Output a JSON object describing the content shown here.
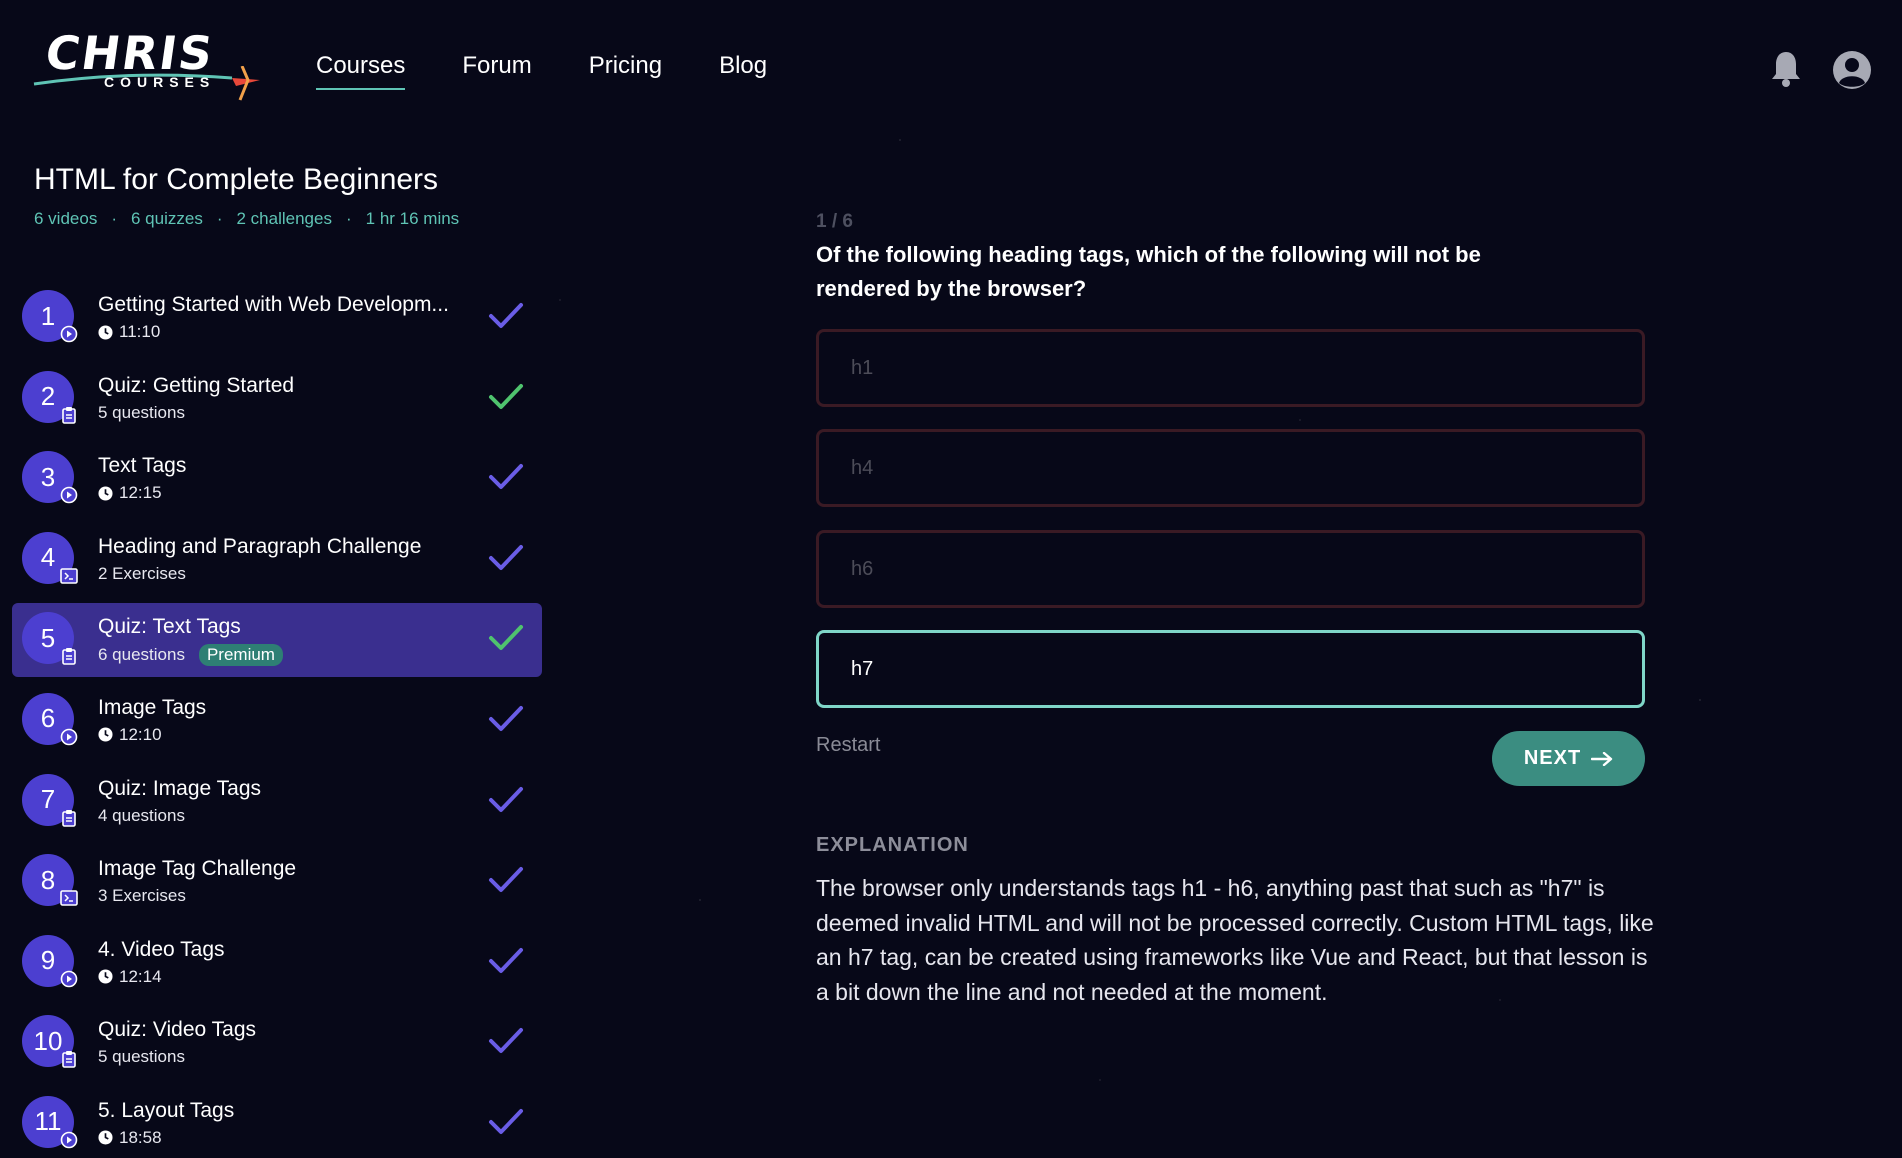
{
  "navbar": {
    "logo_main": "CHRIS",
    "logo_sub": "COURSES",
    "links": [
      {
        "label": "Courses",
        "active": true
      },
      {
        "label": "Forum"
      },
      {
        "label": "Pricing"
      },
      {
        "label": "Blog"
      }
    ],
    "icons": [
      "bell-icon",
      "user-avatar-icon"
    ]
  },
  "course": {
    "title": "HTML for Complete Beginners",
    "meta": [
      "6 videos",
      "6 quizzes",
      "2 challenges",
      "1 hr 16 mins"
    ],
    "separator": "·"
  },
  "lessons": [
    {
      "num": "1",
      "title": "Getting Started with Web Developm...",
      "sub": "11:10",
      "kind": "video",
      "check_color": "#6a5de6"
    },
    {
      "num": "2",
      "title": "Quiz: Getting Started",
      "sub": "5 questions",
      "kind": "quiz",
      "check_color": "#4fc36e"
    },
    {
      "num": "3",
      "title": "Text Tags",
      "sub": "12:15",
      "kind": "video",
      "check_color": "#6a5de6"
    },
    {
      "num": "4",
      "title": "Heading and Paragraph Challenge",
      "sub": "2 Exercises",
      "kind": "challenge",
      "check_color": "#6a5de6"
    },
    {
      "num": "5",
      "title": "Quiz: Text Tags",
      "sub": "6 questions",
      "kind": "quiz",
      "premium": "Premium",
      "active": true,
      "check_color": "#4fc36e"
    },
    {
      "num": "6",
      "title": "Image Tags",
      "sub": "12:10",
      "kind": "video",
      "check_color": "#6a5de6"
    },
    {
      "num": "7",
      "title": "Quiz: Image Tags",
      "sub": "4 questions",
      "kind": "quiz",
      "check_color": "#6a5de6"
    },
    {
      "num": "8",
      "title": "Image Tag Challenge",
      "sub": "3 Exercises",
      "kind": "challenge",
      "check_color": "#6a5de6"
    },
    {
      "num": "9",
      "title": "4. Video Tags",
      "sub": "12:14",
      "kind": "video",
      "check_color": "#6a5de6"
    },
    {
      "num": "10",
      "title": "Quiz: Video Tags",
      "sub": "5 questions",
      "kind": "quiz",
      "check_color": "#6a5de6"
    },
    {
      "num": "11",
      "title": "5. Layout Tags",
      "sub": "18:58",
      "kind": "video",
      "check_color": "#6a5de6"
    }
  ],
  "quiz": {
    "counter": "1 / 6",
    "question": "Of the following heading tags, which of the following will not be rendered by the browser?",
    "answers": [
      {
        "label": "h1"
      },
      {
        "label": "h4"
      },
      {
        "label": "h6"
      },
      {
        "label": "h7",
        "selected": true
      }
    ],
    "restart_label": "Restart",
    "next_label": "NEXT",
    "explanation_label": "EXPLANATION",
    "explanation_text": "The browser only understands tags h1 - h6, anything past that such as \"h7\" is deemed invalid HTML and will not be processed correctly. Custom HTML tags, like an h7 tag, can be created using frameworks like Vue and React, but that lesson is a bit down the line and not needed at the moment."
  },
  "colors": {
    "accent_teal": "#5fc4b5",
    "lesson_circle": "#4c3fd0",
    "active_row": "#3a2f8f",
    "check_purple": "#6a5de6",
    "check_green": "#4fc36e",
    "next_button": "#3b8d81"
  }
}
